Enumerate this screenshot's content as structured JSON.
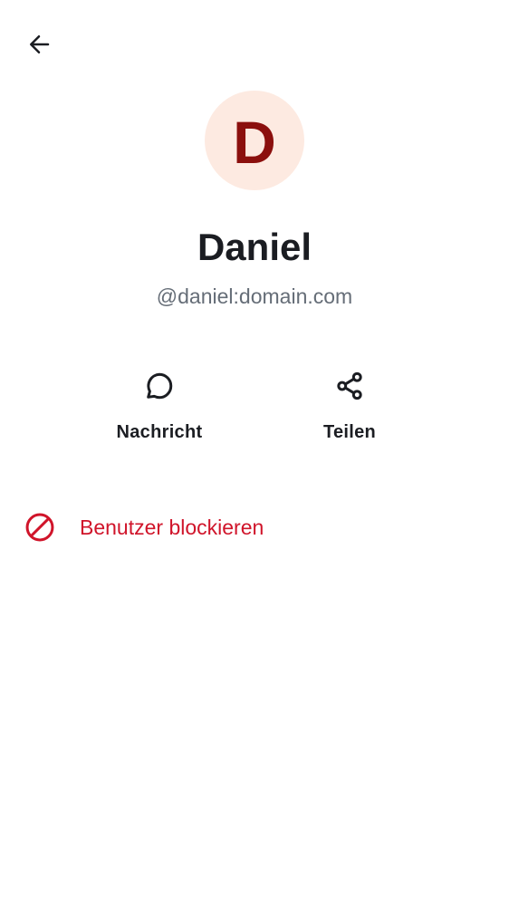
{
  "header": {
    "back_icon": "arrow-left-icon"
  },
  "profile": {
    "avatar_letter": "D",
    "avatar_bg": "#fdeae1",
    "avatar_fg": "#8b0f0d",
    "display_name": "Daniel",
    "user_id": "@daniel:domain.com"
  },
  "actions": [
    {
      "label": "Nachricht",
      "icon": "chat-bubble-icon"
    },
    {
      "label": "Teilen",
      "icon": "share-icon"
    }
  ],
  "block": {
    "label": "Benutzer blockieren",
    "icon": "block-icon",
    "color": "#d0142a"
  }
}
